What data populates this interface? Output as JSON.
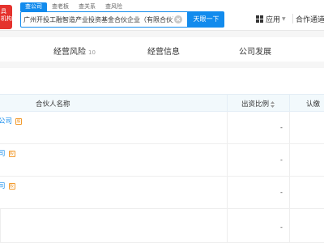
{
  "header": {
    "logo_lines": [
      "具",
      "机构"
    ],
    "search_tabs": [
      "查公司",
      "查老板",
      "查关系",
      "查风险"
    ],
    "search_value": "广州开投工融智造产业投资基金合伙企业（有限合伙）",
    "search_button": "天眼一下",
    "nav_app": "应用",
    "nav_partner": "合作通道"
  },
  "module_tabs": [
    {
      "label": "经营风险",
      "count": "10"
    },
    {
      "label": "经营信息",
      "count": ""
    },
    {
      "label": "公司发展",
      "count": ""
    }
  ],
  "table": {
    "headers": {
      "partner": "合伙人名称",
      "ratio": "出资比例",
      "subscribed": "认缴"
    },
    "rows": [
      {
        "name": "公司",
        "tag": "股",
        "ratio": "-"
      },
      {
        "name": "司",
        "tag": "股",
        "ratio": "-"
      },
      {
        "name": "司",
        "tag": "股",
        "ratio": "-"
      },
      {
        "name": "",
        "tag": "",
        "ratio": "-"
      }
    ]
  },
  "colors": {
    "brand_red": "#e5322d",
    "accent_blue": "#128bed",
    "tag_orange": "#f29b2e"
  }
}
